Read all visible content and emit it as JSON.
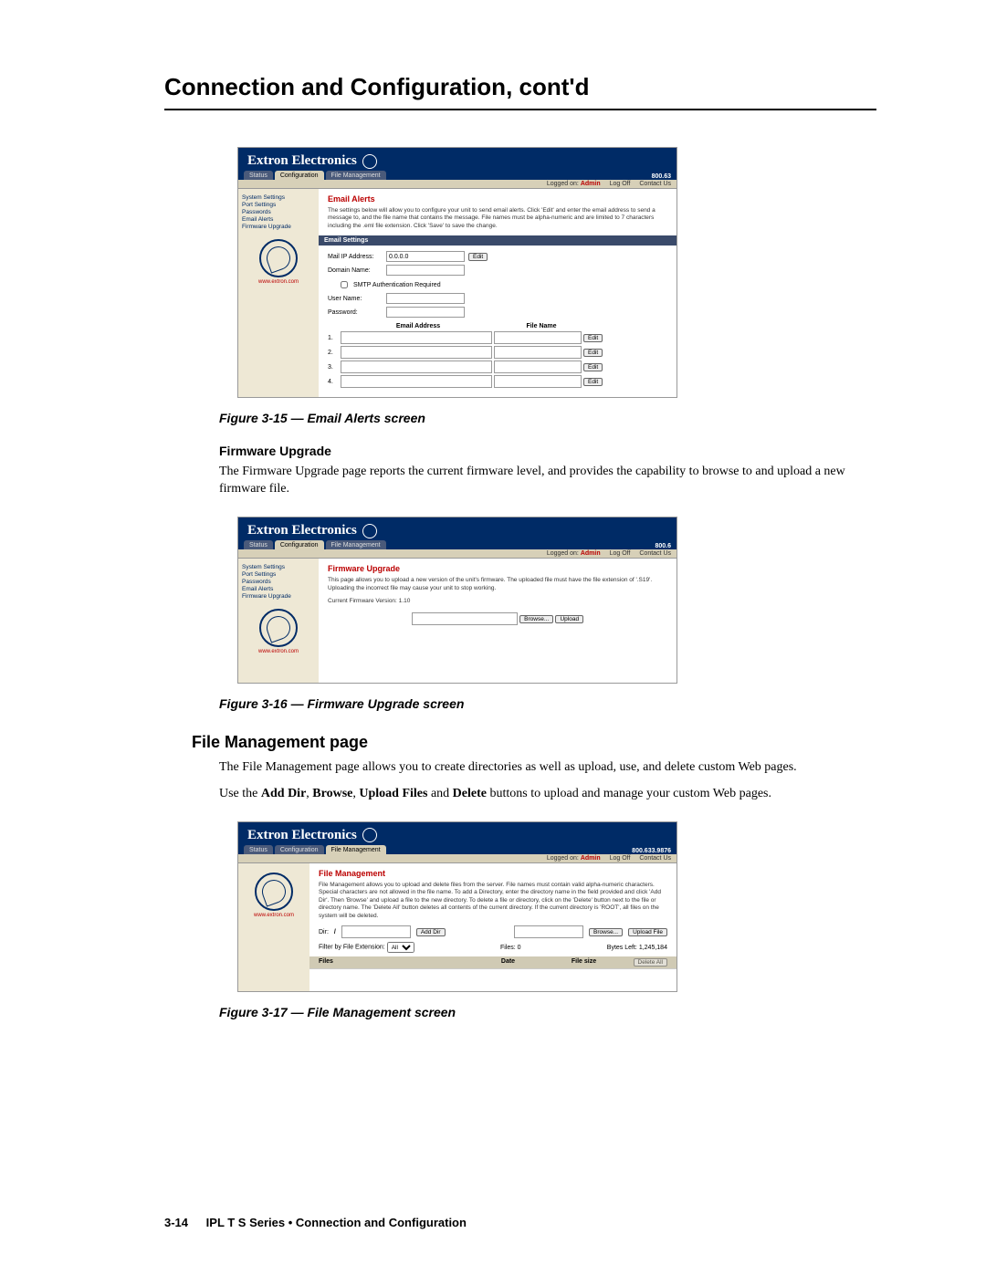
{
  "page_title": "Connection and Configuration, cont'd",
  "common": {
    "brand": "Extron Electronics",
    "tabs": {
      "status": "Status",
      "configuration": "Configuration",
      "file_management": "File Management"
    },
    "statusbar": {
      "logged_on_label": "Logged on:",
      "logged_on_user": "Admin",
      "logoff": "Log Off",
      "contact": "Contact Us"
    },
    "sidebar": {
      "system_settings": "System Settings",
      "port_settings": "Port Settings",
      "passwords": "Passwords",
      "email_alerts": "Email Alerts",
      "firmware_upgrade": "Firmware Upgrade",
      "url": "www.extron.com"
    }
  },
  "fig15": {
    "phone": "800.63",
    "title": "Email Alerts",
    "description": "The settings below will allow you to configure your unit to send email alerts. Click 'Edit' and enter the email address to send a message to, and the file name that contains the message. File names must be alpha-numeric and are limited to 7 characters including the .eml file extension. Click 'Save' to save the change.",
    "section_bar": "Email Settings",
    "mail_ip_label": "Mail IP Address:",
    "mail_ip_value": "0.0.0.0",
    "edit_btn": "Edit",
    "domain_label": "Domain Name:",
    "smtp_auth": "SMTP Authentication Required",
    "user_label": "User Name:",
    "password_label": "Password:",
    "col_email": "Email Address",
    "col_filename": "File Name",
    "rows": [
      "1.",
      "2.",
      "3.",
      "4."
    ],
    "caption": "Figure 3-15 — Email Alerts screen"
  },
  "firmware_section": {
    "heading": "Firmware Upgrade",
    "text": "The Firmware Upgrade page reports the current firmware level, and provides the capability to browse to and upload a new firmware file."
  },
  "fig16": {
    "phone": "800.6",
    "title": "Firmware Upgrade",
    "description": "This page allows you to upload a new version of the unit's firmware. The uploaded file must have the file extension of '.S19'. Uploading the incorrect file may cause your unit to stop working.",
    "version_label": "Current Firmware Version: 1.10",
    "browse_btn": "Browse...",
    "upload_btn": "Upload",
    "caption": "Figure 3-16 — Firmware Upgrade screen"
  },
  "file_mgmt_section": {
    "heading": "File Management page",
    "p1": "The File Management page allows you to create directories as well as upload, use, and delete custom Web pages.",
    "p2_pre": "Use the ",
    "p2_b1": "Add Dir",
    "p2_sep": ", ",
    "p2_b2": "Browse",
    "p2_b3": "Upload Files",
    "p2_and": " and ",
    "p2_b4": "Delete",
    "p2_post": " buttons to upload and manage your custom Web pages."
  },
  "fig17": {
    "phone": "800.633.9876",
    "title": "File Management",
    "description": "File Management allows you to upload and delete files from the server. File names must contain valid alpha-numeric characters. Special characters are not allowed in the file name. To add a Directory, enter the directory name in the field provided and click 'Add Dir'. Then 'Browse' and upload a file to the new directory. To delete a file or directory, click on the 'Delete' button next to the file or directory name. The 'Delete All' button deletes all contents of the current directory. If the current directory is 'ROOT', all files on the system will be deleted.",
    "dir_label": "Dir:",
    "dir_value": "/",
    "add_dir_btn": "Add Dir",
    "browse_btn": "Browse...",
    "upload_file_btn": "Upload File",
    "filter_label": "Filter by File Extension:",
    "filter_value": "All",
    "files_label": "Files:",
    "files_count": "0",
    "bytes_left_label": "Bytes Left:",
    "bytes_left_value": "1,245,184",
    "col_files": "Files",
    "col_date": "Date",
    "col_size": "File size",
    "delete_all_btn": "Delete All",
    "caption": "Figure 3-17 — File Management screen"
  },
  "footer": {
    "page_number": "3-14",
    "text": "IPL T S Series • Connection and Configuration"
  }
}
